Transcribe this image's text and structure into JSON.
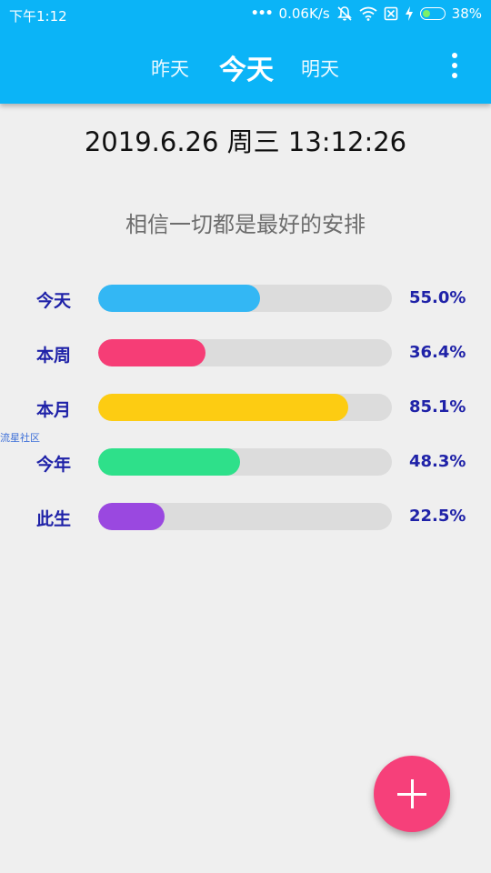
{
  "status_bar": {
    "time": "下午1:12",
    "dots": "•••",
    "net_speed": "0.06K/s",
    "battery_percent": "38%",
    "battery_level": 0.38,
    "battery_color": "#7cf06a",
    "icons": [
      "mute-bell-icon",
      "wifi-icon",
      "sim-icon",
      "charging-icon",
      "battery-icon"
    ]
  },
  "header": {
    "accent_color": "#0bb4f7",
    "tabs": [
      {
        "label": "昨天",
        "active": false
      },
      {
        "label": "今天",
        "active": true
      },
      {
        "label": "明天",
        "active": false
      }
    ],
    "menu_icon": "more-vertical-icon"
  },
  "main": {
    "datetime": "2019.6.26 周三 13:12:26",
    "motto": "相信一切都是最好的安排",
    "progress": [
      {
        "label": "今天",
        "percent_text": "55.0%",
        "value": 55.0,
        "color": "#33b7f4"
      },
      {
        "label": "本周",
        "percent_text": "36.4%",
        "value": 36.4,
        "color": "#f63d76"
      },
      {
        "label": "本月",
        "percent_text": "85.1%",
        "value": 85.1,
        "color": "#fdcc12"
      },
      {
        "label": "今年",
        "percent_text": "48.3%",
        "value": 48.3,
        "color": "#2ee08a"
      },
      {
        "label": "此生",
        "percent_text": "22.5%",
        "value": 22.5,
        "color": "#9a48e0"
      }
    ]
  },
  "watermark": "流星社区",
  "fab": {
    "icon": "plus-icon",
    "color": "#f6407a"
  }
}
